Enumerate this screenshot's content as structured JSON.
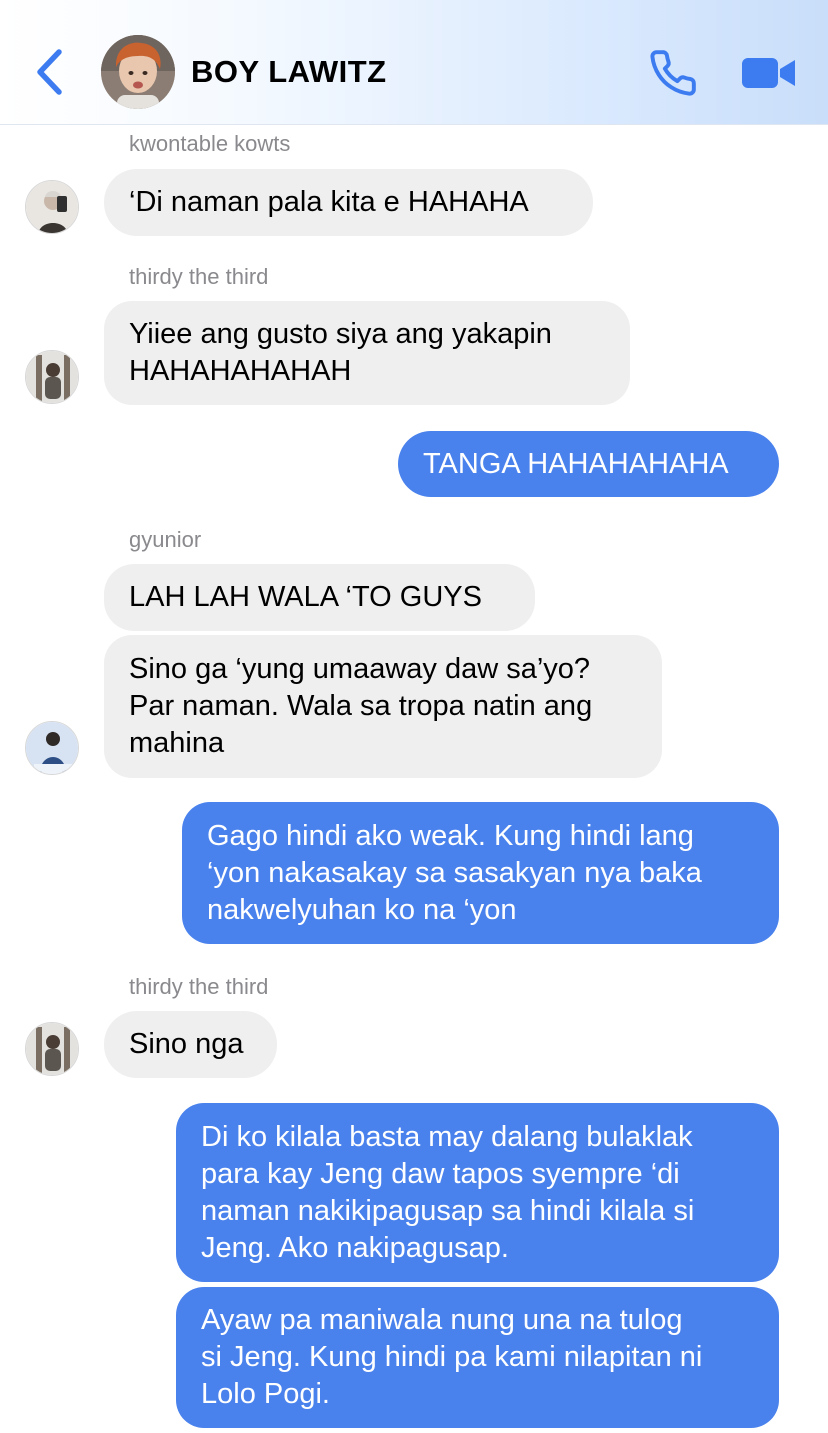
{
  "header": {
    "contact_name": "BOY LAWITZ"
  },
  "icons": {
    "back": "chevron-left-icon",
    "call": "phone-icon",
    "video": "video-camera-icon"
  },
  "colors": {
    "accent": "#3d7cf0",
    "outgoing_bubble": "#4a82ed",
    "incoming_bubble": "#efefef",
    "sender_label": "#8a8a8e"
  },
  "messages": [
    {
      "sender": "kwontable kowts",
      "text": "‘Di naman pala kita e HAHAHA"
    },
    {
      "sender": "thirdy the third",
      "lines": [
        "Yiiee ang gusto siya ang yakapin",
        "HAHAHAHAHAH"
      ]
    },
    {
      "text": "TANGA HAHAHAHAHA"
    },
    {
      "sender": "gyunior",
      "text": "LAH LAH WALA ‘TO GUYS"
    },
    {
      "lines": [
        "Sino ga ‘yung umaaway daw sa’yo?",
        "Par naman. Wala sa tropa natin ang",
        "mahina"
      ]
    },
    {
      "lines": [
        "Gago hindi ako weak. Kung hindi lang",
        "‘yon nakasakay sa sasakyan nya baka",
        "nakwelyuhan ko na ‘yon"
      ]
    },
    {
      "sender": "thirdy the third",
      "text": "Sino nga"
    },
    {
      "lines": [
        "Di ko kilala basta may dalang bulaklak",
        "para kay Jeng daw tapos syempre ‘di",
        "naman nakikipagusap sa hindi kilala si",
        "Jeng. Ako nakipagusap."
      ]
    },
    {
      "lines": [
        "Ayaw pa maniwala nung una na tulog",
        "si Jeng. Kung hindi pa kami nilapitan ni",
        "Lolo Pogi."
      ]
    }
  ]
}
